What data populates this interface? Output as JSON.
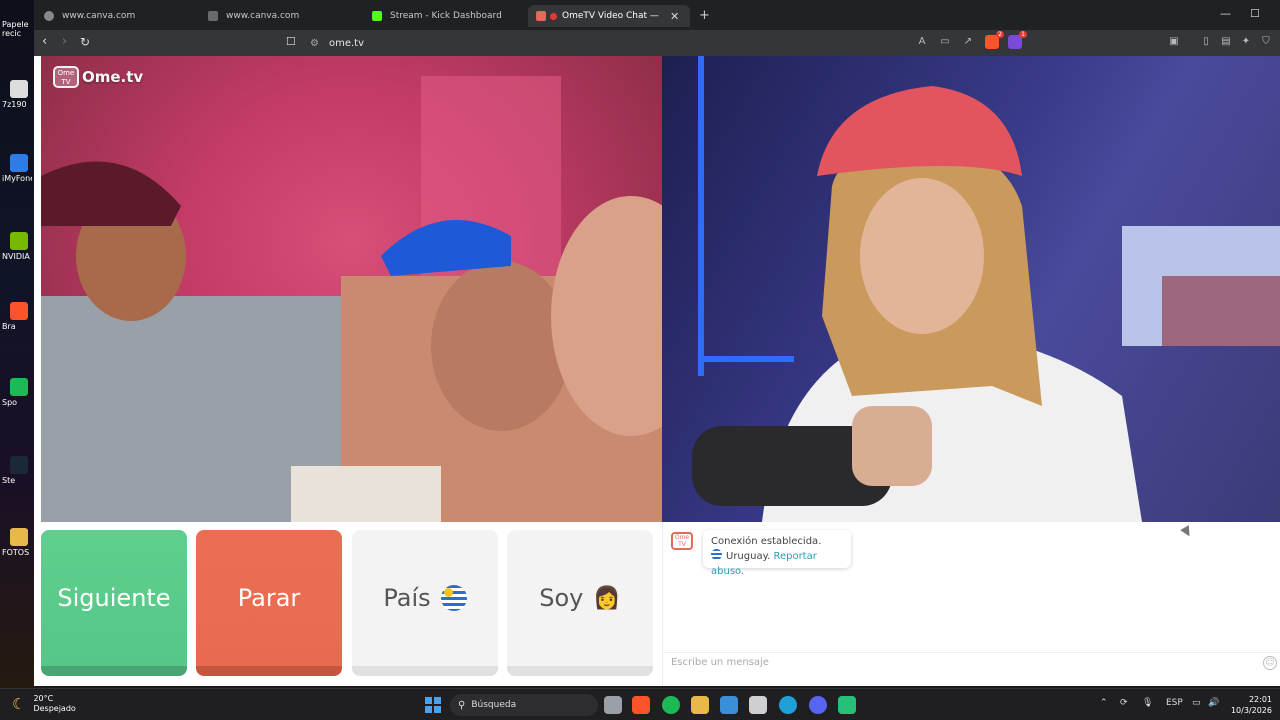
{
  "desktop": {
    "items": [
      "Papele recic",
      "7z190",
      "iMyFone",
      "NVIDIA",
      "Bra",
      "Spo",
      "Ste",
      "FOTOS"
    ]
  },
  "browser": {
    "tabs": [
      {
        "title": "www.canva.com"
      },
      {
        "title": "www.canva.com"
      },
      {
        "title": "Stream - Kick Dashboard"
      },
      {
        "title": "OmeTV Video Chat — Omeg"
      }
    ],
    "url": "ome.tv",
    "brave_badge": "2",
    "rewards_badge": "1"
  },
  "site": {
    "logo_text": "Ome.tv",
    "logo_tv": "Ome TV",
    "buttons": {
      "next": "Siguiente",
      "stop": "Parar",
      "country": "País",
      "gender": "Soy",
      "gender_emoji": "👩"
    },
    "chat": {
      "status": "Conexión establecida.",
      "country": "Uruguay.",
      "report": "Reportar abuso.",
      "placeholder": "Escribe un mensaje"
    }
  },
  "taskbar": {
    "temp": "20°C",
    "weather": "Despejado",
    "search": "Búsqueda",
    "lang": "ESP",
    "time": "22:01",
    "date": "10/3/2026"
  }
}
